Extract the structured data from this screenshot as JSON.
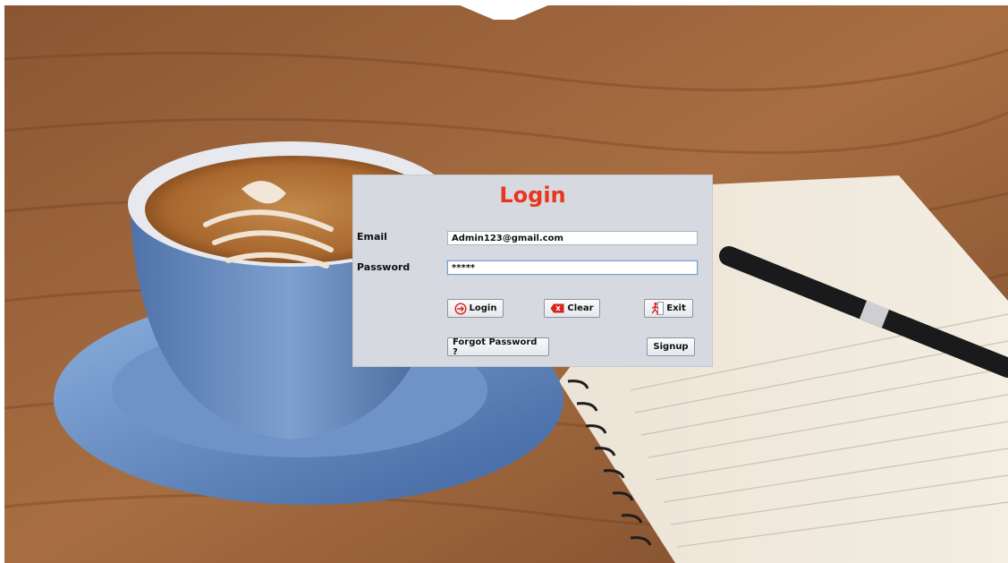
{
  "form": {
    "title": "Login",
    "email_label": "Email",
    "email_value": "Admin123@gmail.com",
    "password_label": "Password",
    "password_value": "*****"
  },
  "buttons": {
    "login": "Login",
    "clear": "Clear",
    "exit": "Exit",
    "forgot": "Forgot Password ?",
    "signup": "Signup"
  },
  "colors": {
    "title": "#e8361e",
    "panel": "#d6d9e0"
  },
  "icons": {
    "login": "login-arrow-icon",
    "clear": "eraser-icon",
    "exit": "exit-runner-icon"
  }
}
